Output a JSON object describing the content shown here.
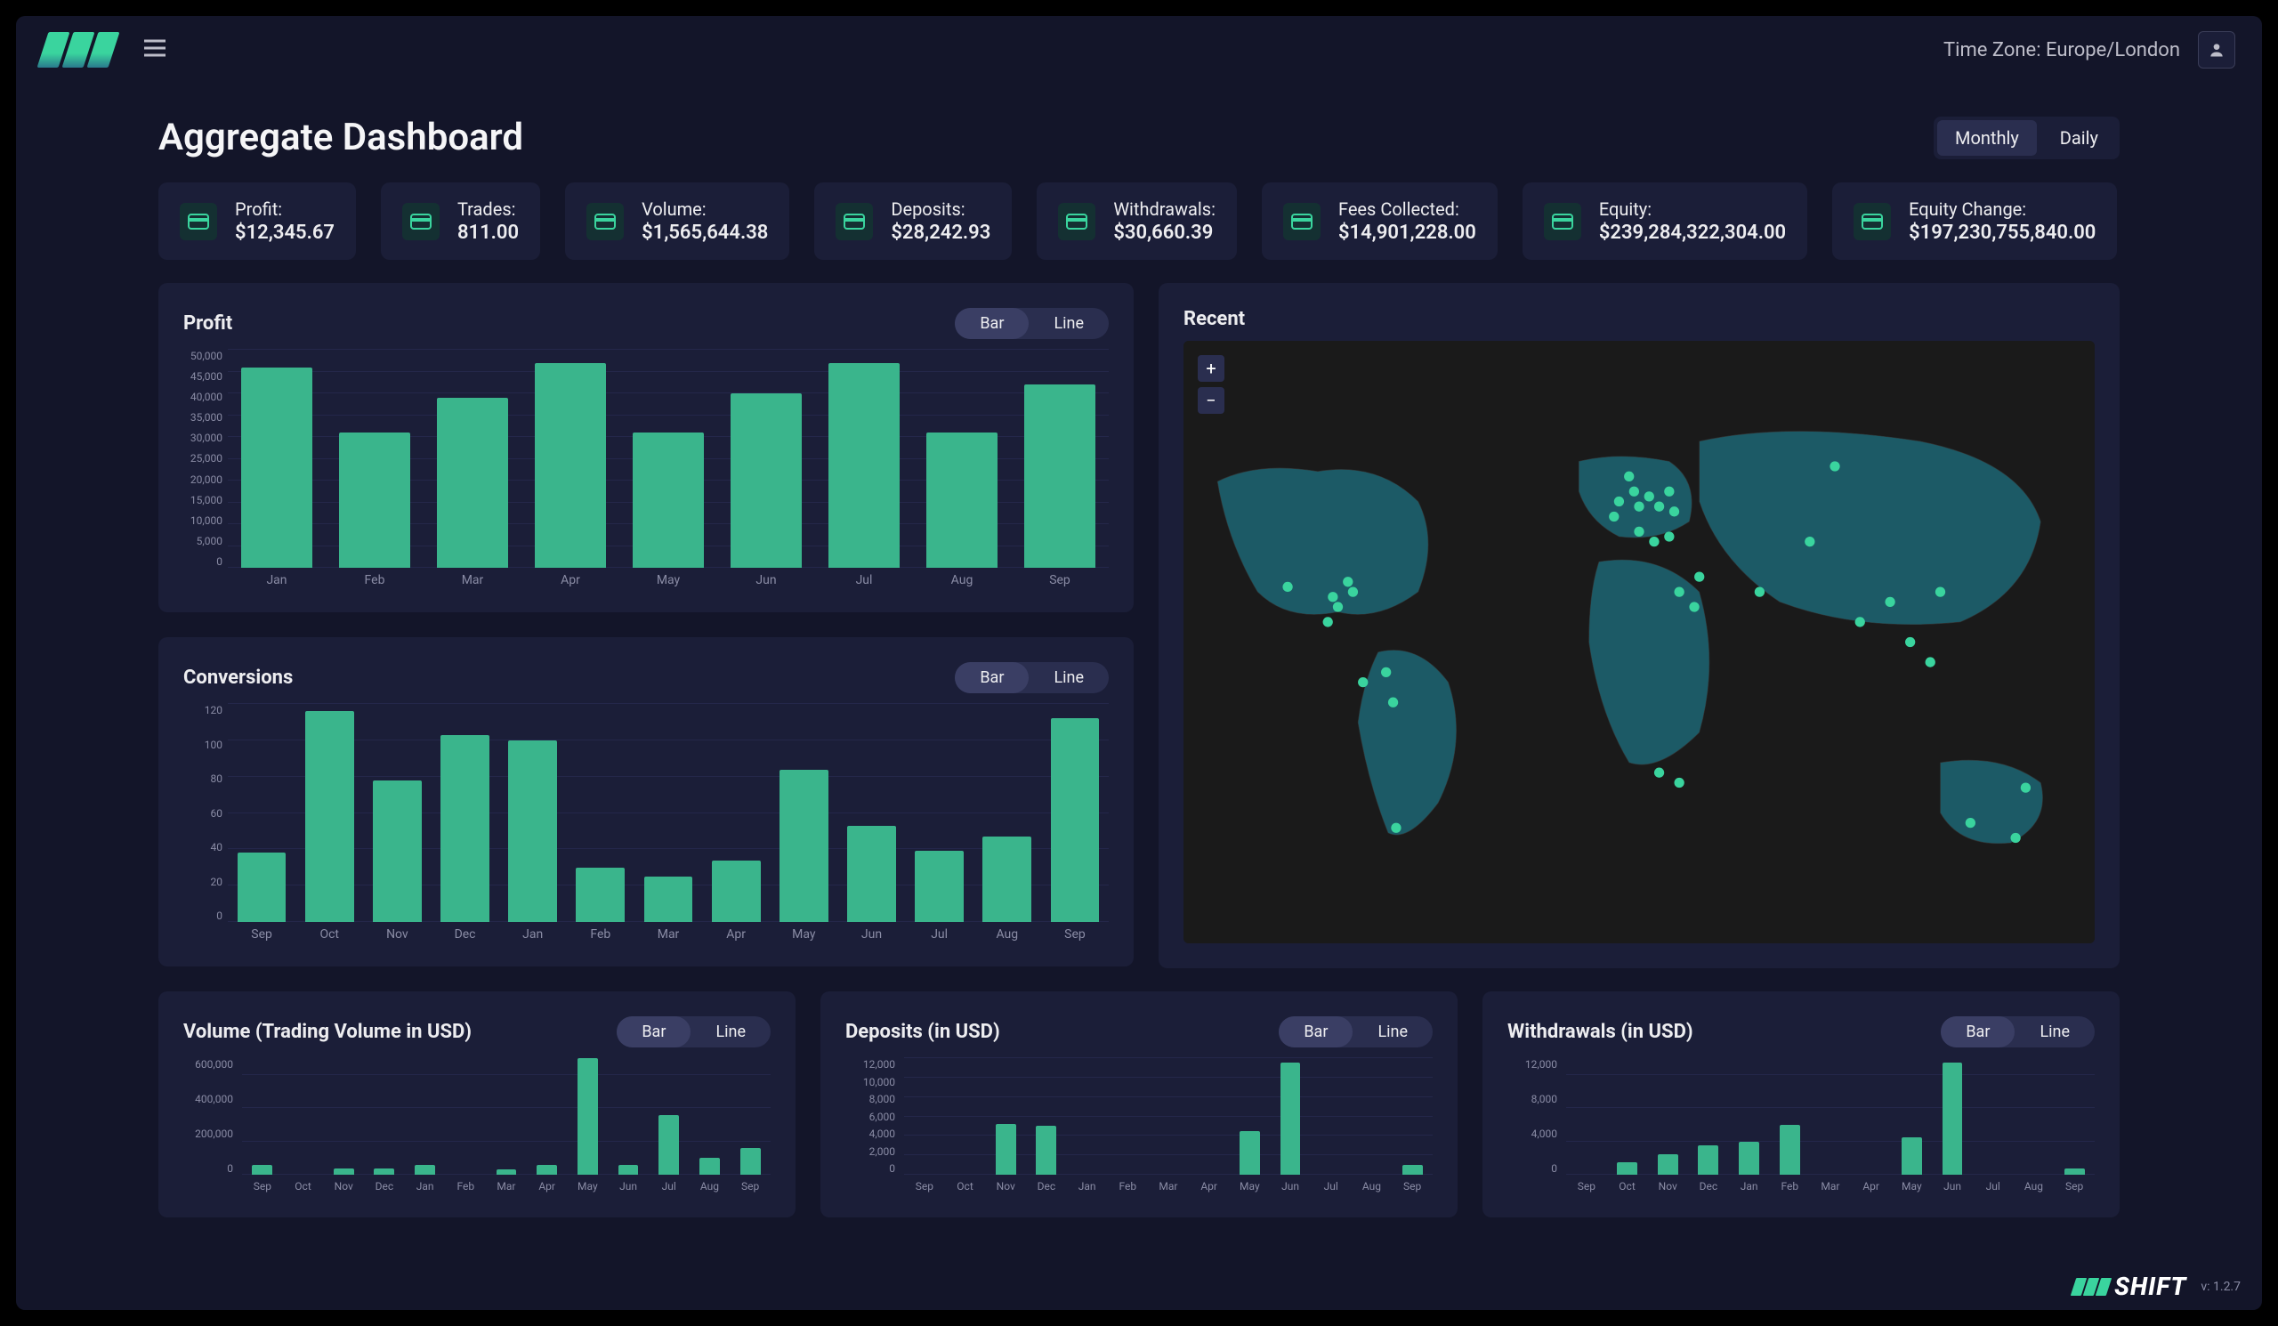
{
  "header": {
    "timezone": "Time Zone: Europe/London",
    "page_title": "Aggregate Dashboard",
    "tabs": {
      "monthly": "Monthly",
      "daily": "Daily",
      "active": "Monthly"
    }
  },
  "stats": [
    {
      "label": "Profit:",
      "value": "$12,345.67"
    },
    {
      "label": "Trades:",
      "value": "811.00"
    },
    {
      "label": "Volume:",
      "value": "$1,565,644.38"
    },
    {
      "label": "Deposits:",
      "value": "$28,242.93"
    },
    {
      "label": "Withdrawals:",
      "value": "$30,660.39"
    },
    {
      "label": "Fees Collected:",
      "value": "$14,901,228.00"
    },
    {
      "label": "Equity:",
      "value": "$239,284,322,304.00"
    },
    {
      "label": "Equity Change:",
      "value": "$197,230,755,840.00"
    }
  ],
  "panels": {
    "profit": {
      "title": "Profit",
      "toggle_bar": "Bar",
      "toggle_line": "Line"
    },
    "conversions": {
      "title": "Conversions",
      "toggle_bar": "Bar",
      "toggle_line": "Line"
    },
    "recent": {
      "title": "Recent"
    },
    "volume": {
      "title": "Volume (Trading Volume in USD)",
      "toggle_bar": "Bar",
      "toggle_line": "Line"
    },
    "deposits": {
      "title": "Deposits (in USD)",
      "toggle_bar": "Bar",
      "toggle_line": "Line"
    },
    "withdrawals": {
      "title": "Withdrawals (in USD)",
      "toggle_bar": "Bar",
      "toggle_line": "Line"
    }
  },
  "chart_data": [
    {
      "id": "profit",
      "type": "bar",
      "title": "Profit",
      "categories": [
        "Jan",
        "Feb",
        "Mar",
        "Apr",
        "May",
        "Jun",
        "Jul",
        "Aug",
        "Sep"
      ],
      "values": [
        46000,
        31000,
        39000,
        47000,
        31000,
        40000,
        47000,
        31000,
        42000
      ],
      "ylim": [
        0,
        50000
      ],
      "yticks": [
        0,
        5000,
        10000,
        15000,
        20000,
        25000,
        30000,
        35000,
        40000,
        45000,
        50000
      ],
      "ytick_labels": [
        "0",
        "5,000",
        "10,000",
        "15,000",
        "20,000",
        "25,000",
        "30,000",
        "35,000",
        "40,000",
        "45,000",
        "50,000"
      ]
    },
    {
      "id": "conversions",
      "type": "bar",
      "title": "Conversions",
      "categories": [
        "Sep",
        "Oct",
        "Nov",
        "Dec",
        "Jan",
        "Feb",
        "Mar",
        "Apr",
        "May",
        "Jun",
        "Jul",
        "Aug",
        "Sep"
      ],
      "values": [
        38,
        116,
        78,
        103,
        100,
        30,
        25,
        34,
        84,
        53,
        39,
        47,
        112
      ],
      "ylim": [
        0,
        120
      ],
      "yticks": [
        0,
        20,
        40,
        60,
        80,
        100,
        120
      ],
      "ytick_labels": [
        "0",
        "20",
        "40",
        "60",
        "80",
        "100",
        "120"
      ]
    },
    {
      "id": "volume",
      "type": "bar",
      "title": "Volume (Trading Volume in USD)",
      "categories": [
        "Sep",
        "Oct",
        "Nov",
        "Dec",
        "Jan",
        "Feb",
        "Mar",
        "Apr",
        "May",
        "Jun",
        "Jul",
        "Aug",
        "Sep"
      ],
      "values": [
        60000,
        0,
        40000,
        40000,
        60000,
        0,
        30000,
        60000,
        700000,
        60000,
        360000,
        100000,
        160000
      ],
      "ylim": [
        0,
        700000
      ],
      "yticks": [
        0,
        200000,
        400000,
        600000
      ],
      "ytick_labels": [
        "0",
        "200,000",
        "400,000",
        "600,000"
      ]
    },
    {
      "id": "deposits",
      "type": "bar",
      "title": "Deposits (in USD)",
      "categories": [
        "Sep",
        "Oct",
        "Nov",
        "Dec",
        "Jan",
        "Feb",
        "Mar",
        "Apr",
        "May",
        "Jun",
        "Jul",
        "Aug",
        "Sep"
      ],
      "values": [
        0,
        0,
        5200,
        5000,
        0,
        0,
        0,
        0,
        4500,
        11500,
        0,
        0,
        1000
      ],
      "ylim": [
        0,
        12000
      ],
      "yticks": [
        0,
        2000,
        4000,
        6000,
        8000,
        10000,
        12000
      ],
      "ytick_labels": [
        "0",
        "2,000",
        "4,000",
        "6,000",
        "8,000",
        "10,000",
        "12,000"
      ]
    },
    {
      "id": "withdrawals",
      "type": "bar",
      "title": "Withdrawals (in USD)",
      "categories": [
        "Sep",
        "Oct",
        "Nov",
        "Dec",
        "Jan",
        "Feb",
        "Mar",
        "Apr",
        "May",
        "Jun",
        "Jul",
        "Aug",
        "Sep"
      ],
      "values": [
        0,
        1500,
        2500,
        3500,
        4000,
        6000,
        0,
        0,
        4500,
        13500,
        0,
        0,
        700
      ],
      "ylim": [
        0,
        14000
      ],
      "yticks": [
        0,
        4000,
        8000,
        12000
      ],
      "ytick_labels": [
        "0",
        "4,000",
        "8,000",
        "12,000"
      ]
    }
  ],
  "footer": {
    "brand": "SHIFT",
    "version": "v: 1.2.7"
  }
}
